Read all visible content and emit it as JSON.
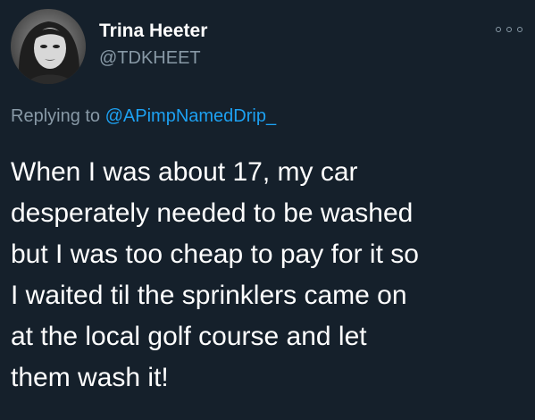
{
  "author": {
    "display_name": "Trina Heeter",
    "handle": "@TDKHEET"
  },
  "more_icon": "more-horizontal-icon",
  "reply": {
    "prefix": "Replying to",
    "mention": "@APimpNamedDrip_"
  },
  "tweet": {
    "lines": [
      "When I was about 17, my car",
      "desperately needed to be washed",
      "but I was too cheap to pay for it so",
      "I waited til the sprinklers came on",
      "at the local golf course and let",
      "them wash it!"
    ]
  },
  "colors": {
    "background": "#15202b",
    "primary_text": "#ffffff",
    "secondary_text": "#8899a6",
    "accent": "#1da1f2"
  }
}
